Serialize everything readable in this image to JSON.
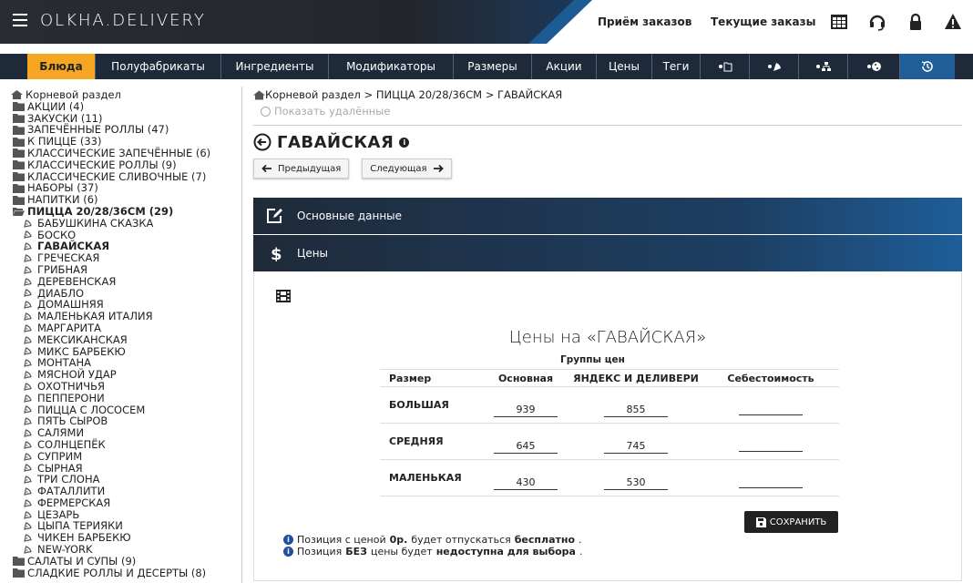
{
  "header": {
    "logo": "OLKHA.DELIVERY",
    "links": [
      "Приём заказов",
      "Текущие заказы"
    ],
    "icons": [
      "table-icon",
      "headset-icon",
      "lock-icon",
      "warning-icon"
    ]
  },
  "tabs": [
    "Блюда",
    "Полуфабрикаты",
    "Ингредиенты",
    "Модификаторы",
    "Размеры",
    "Акции",
    "Цены",
    "Теги"
  ],
  "tab_icons": [
    "folder-icon",
    "pizza-icon",
    "sitemap-icon",
    "cookie-icon",
    "history-icon"
  ],
  "sidebar": {
    "root": "Корневой раздел",
    "folders_top": [
      "АКЦИИ (4)",
      "ЗАКУСКИ (11)",
      "ЗАПЕЧЁННЫЕ РОЛЛЫ (47)",
      "К ПИЦЦЕ (33)",
      "КЛАССИЧЕСКИЕ ЗАПЕЧЁННЫЕ (6)",
      "КЛАССИЧЕСКИЕ РОЛЛЫ (9)",
      "КЛАССИЧЕСКИЕ СЛИВОЧНЫЕ (7)",
      "НАБОРЫ (37)",
      "НАПИТКИ (6)"
    ],
    "open_folder": "ПИЦЦА 20/28/36СМ (29)",
    "items": [
      "БАБУШКИНА СКАЗКА",
      "БОСКО",
      "ГАВАЙСКАЯ",
      "ГРЕЧЕСКАЯ",
      "ГРИБНАЯ",
      "ДЕРЕВЕНСКАЯ",
      "ДИАБЛО",
      "ДОМАШНЯЯ",
      "МАЛЕНЬКАЯ ИТАЛИЯ",
      "МАРГАРИТА",
      "МЕКСИКАНСКАЯ",
      "МИКС БАРБЕКЮ",
      "МОНТАНА",
      "МЯСНОЙ УДАР",
      "ОХОТНИЧЬЯ",
      "ПЕППЕРОНИ",
      "ПИЦЦА С ЛОСОСЕМ",
      "ПЯТЬ СЫРОВ",
      "САЛЯМИ",
      "СОЛНЦЕПЁК",
      "СУПРИМ",
      "СЫРНАЯ",
      "ТРИ СЛОНА",
      "ФАТАЛЛИТИ",
      "ФЕРМЕРСКАЯ",
      "ЦЕЗАРЬ",
      "ЦЫПА ТЕРИЯКИ",
      "ЧИКЕН БАРБЕКЮ",
      "NEW-YORK"
    ],
    "folders_bottom": [
      "САЛАТЫ И СУПЫ (9)",
      "СЛАДКИЕ РОЛЛЫ И ДЕСЕРТЫ (8)"
    ]
  },
  "main": {
    "breadcrumb": "Корневой раздел > ПИЦЦА 20/28/36СМ > ГАВАЙСКАЯ",
    "show_deleted": "Показать удалённые",
    "title": "ГАВАЙСКАЯ",
    "prev": "Предыдущая",
    "next": "Следующая",
    "panel_main": "Основные данные",
    "panel_prices": "Цены",
    "prices_title": "Цены на «ГАВАЙСКАЯ»",
    "groups_label": "Группы цен",
    "columns": [
      "Размер",
      "Основная",
      "ЯНДЕКС И ДЕЛИВЕРИ",
      "Себестоимость"
    ],
    "rows": [
      {
        "size": "БОЛЬШАЯ",
        "base": "939",
        "yandex": "855",
        "cost": ""
      },
      {
        "size": "СРЕДНЯЯ",
        "base": "645",
        "yandex": "745",
        "cost": ""
      },
      {
        "size": "МАЛЕНЬКАЯ",
        "base": "430",
        "yandex": "530",
        "cost": ""
      }
    ],
    "save": "СОХРАНИТЬ",
    "note1_a": "Позиция с ценой",
    "note1_b": "0р.",
    "note1_c": "будет отпускаться",
    "note1_d": "бесплатно",
    "note2_a": "Позиция",
    "note2_b": "БЕЗ",
    "note2_c": "цены будет",
    "note2_d": "недоступна для выбора"
  }
}
